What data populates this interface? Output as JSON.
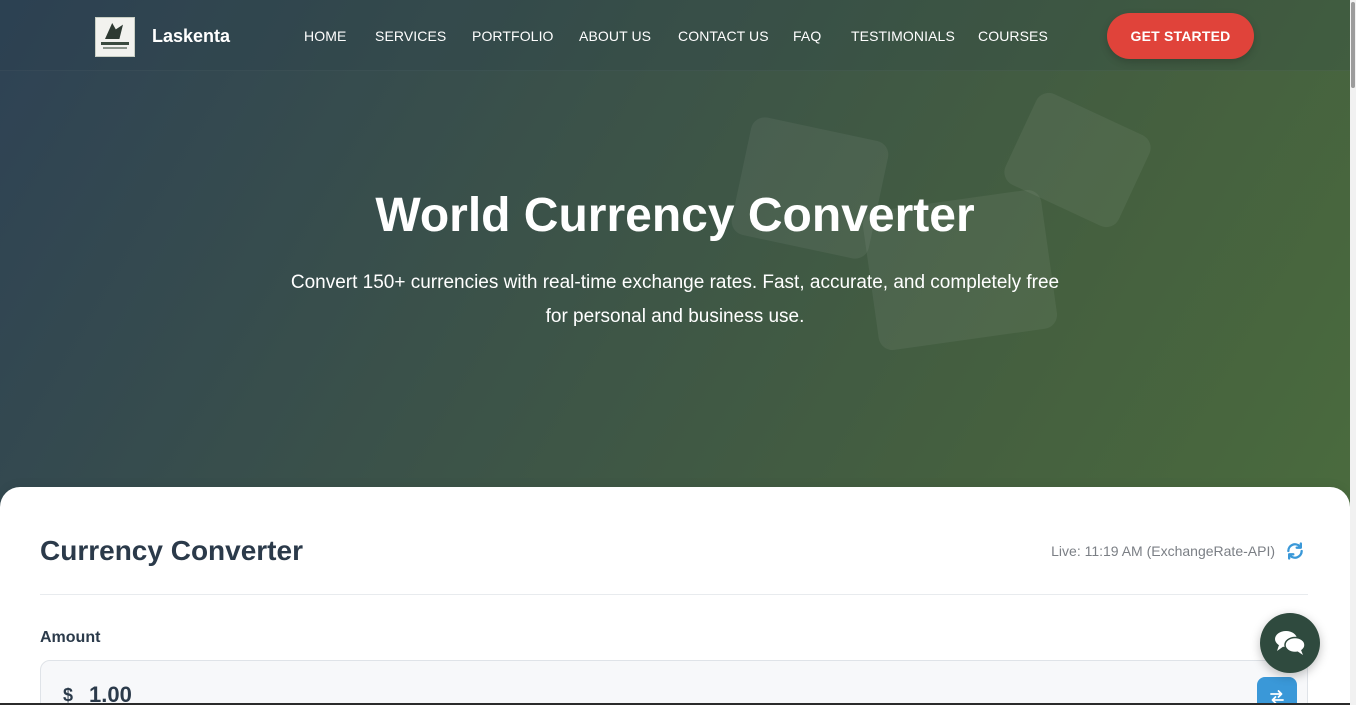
{
  "nav": {
    "brand": "Laskenta",
    "links": [
      "HOME",
      "SERVICES",
      "PORTFOLIO",
      "ABOUT US",
      "CONTACT US",
      "FAQ",
      "TESTIMONIALS",
      "COURSES"
    ],
    "cta": "GET STARTED"
  },
  "hero": {
    "title": "World Currency Converter",
    "subtitle_line1": "Convert 150+ currencies with real-time exchange rates. Fast, accurate, and completely free",
    "subtitle_line2": "for personal and business use."
  },
  "converter": {
    "title": "Currency Converter",
    "live_status": "Live: 11:19 AM (ExchangeRate-API)",
    "amount_label": "Amount",
    "currency_symbol": "$",
    "amount_value": "1.00"
  },
  "colors": {
    "cta": "#e0433a",
    "hero_start": "#2e4255",
    "hero_end": "#4a6b3e",
    "accent_blue": "#3a98d8",
    "heading": "#2b3a4a"
  },
  "icons": {
    "refresh": "refresh-icon",
    "swap": "swap-icon",
    "chat": "chat-icon"
  }
}
